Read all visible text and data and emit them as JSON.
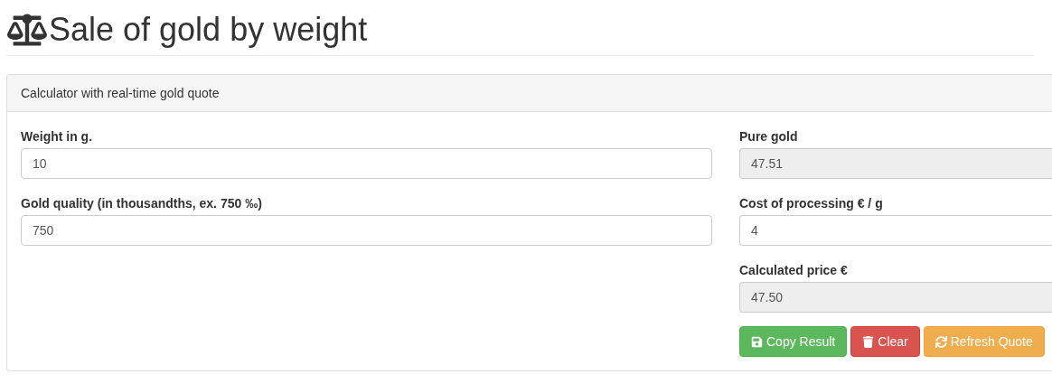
{
  "page_title": "Sale of gold by weight",
  "panel": {
    "heading": "Calculator with real-time gold quote",
    "left_fields": [
      {
        "label": "Weight in g.",
        "value": "10",
        "readonly": false
      },
      {
        "label": "Gold quality (in thousandths, ex. 750 ‰)",
        "value": "750",
        "readonly": false
      }
    ],
    "right_fields": [
      {
        "label": "Pure gold",
        "value": "47.51",
        "readonly": true
      },
      {
        "label": "Cost of processing € / g",
        "value": "4",
        "readonly": false
      },
      {
        "label": "Calculated price €",
        "value": "47.50",
        "readonly": true
      }
    ],
    "buttons": [
      {
        "label": "Copy Result",
        "kind": "success"
      },
      {
        "label": "Clear",
        "kind": "danger"
      },
      {
        "label": "Refresh Quote",
        "kind": "warning"
      }
    ]
  }
}
